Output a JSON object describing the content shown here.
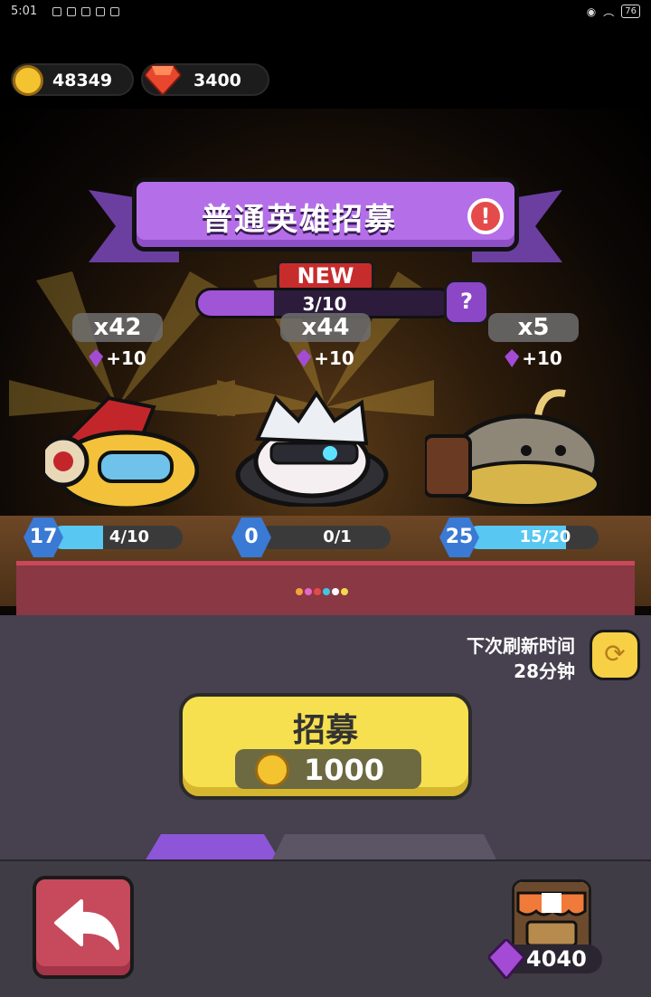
{
  "status_bar": {
    "time": "5:01",
    "battery": "76"
  },
  "currency": {
    "coins": "48349",
    "gems": "3400"
  },
  "banner": {
    "title": "普通英雄招募",
    "info": "!"
  },
  "new_badge": "NEW",
  "progress": {
    "text": "3/10",
    "fraction": 0.3,
    "help": "?"
  },
  "heroes": [
    {
      "count": "x42",
      "gain": "+10",
      "level": "17",
      "progress_text": "4/10",
      "progress": 0.4
    },
    {
      "count": "x44",
      "gain": "+10",
      "level": "0",
      "progress_text": "0/1",
      "progress": 0.0
    },
    {
      "count": "x5",
      "gain": "+10",
      "level": "25",
      "progress_text": "15/20",
      "progress": 0.75
    }
  ],
  "rail_dot_colors": [
    "#f2a43a",
    "#e667c8",
    "#e24a4a",
    "#3ec7e6",
    "#ffffff",
    "#f1d94a"
  ],
  "refresh": {
    "line1": "下次刷新时间",
    "line2": "28分钟"
  },
  "recruit": {
    "label": "招募",
    "price": "1000"
  },
  "shop": {
    "gems": "4040"
  },
  "colors": {
    "banner": "#b46fe8",
    "recruit": "#f6e04f",
    "back": "#c74a5c",
    "level_fill": "#58c7f2"
  }
}
